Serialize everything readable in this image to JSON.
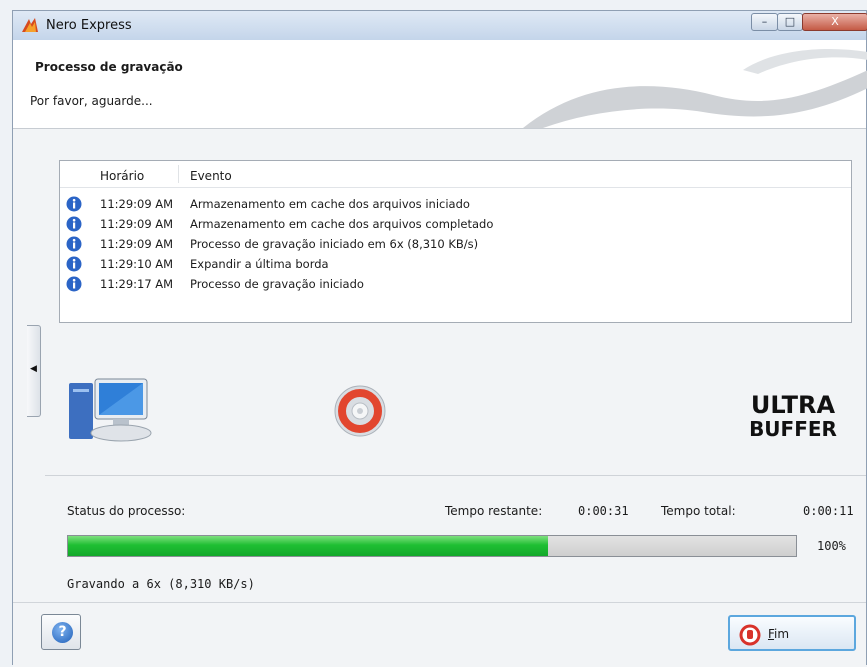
{
  "window": {
    "title": "Nero Express",
    "controls": {
      "minimize": "–",
      "maximize": "□",
      "close": "X"
    }
  },
  "header": {
    "title": "Processo de gravação",
    "subtitle": "Por favor, aguarde..."
  },
  "log": {
    "columns": {
      "time": "Horário",
      "event": "Evento"
    },
    "rows": [
      {
        "time": "11:29:09 AM",
        "event": "Armazenamento em cache dos arquivos iniciado",
        "icon": "info-icon"
      },
      {
        "time": "11:29:09 AM",
        "event": "Armazenamento em cache dos arquivos completado",
        "icon": "info-icon"
      },
      {
        "time": "11:29:09 AM",
        "event": "Processo de gravação iniciado em 6x (8,310 KB/s)",
        "icon": "info-icon"
      },
      {
        "time": "11:29:10 AM",
        "event": "Expandir a última borda",
        "icon": "info-icon"
      },
      {
        "time": "11:29:17 AM",
        "event": "Processo de gravação iniciado",
        "icon": "info-icon"
      }
    ]
  },
  "status": {
    "label": "Status do processo:",
    "remaining_label": "Tempo restante:",
    "remaining_value": "0:00:31",
    "total_label": "Tempo total:",
    "total_value": "0:00:11",
    "percent_text": "100%",
    "progress_fraction": 0.66,
    "progress_color": "#1fbf33",
    "message": "Gravando a 6x (8,310 KB/s)"
  },
  "buttons": {
    "help": "?",
    "end": "Fim",
    "end_mnemonic": "F",
    "end_rest": "im"
  },
  "logo": {
    "text_top": "ULTRA",
    "text_bottom": "BUFFER"
  }
}
